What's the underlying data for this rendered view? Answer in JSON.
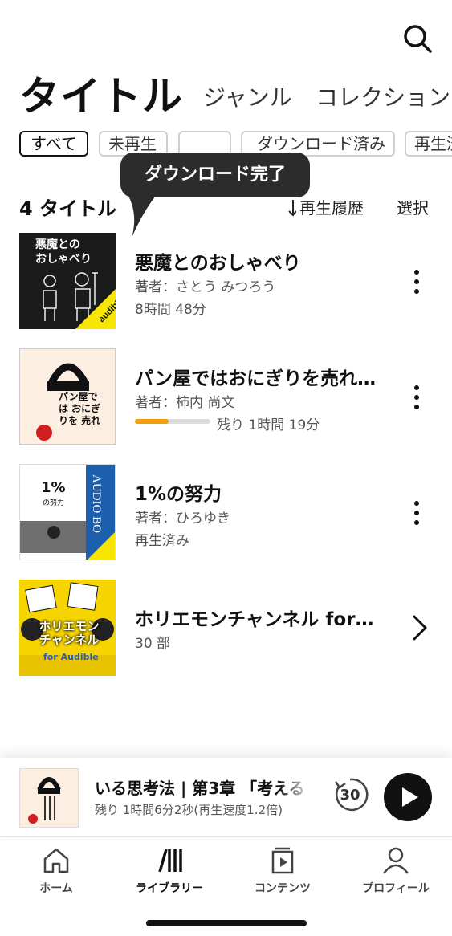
{
  "header": {
    "tabs": [
      {
        "label": "タイトル",
        "active": true
      },
      {
        "label": "ジャンル",
        "active": false
      },
      {
        "label": "コレクション",
        "active": false
      }
    ],
    "search_icon": "search-icon"
  },
  "filters": [
    {
      "label": "すべて",
      "active": true
    },
    {
      "label": "未再生",
      "active": false
    },
    {
      "label": "",
      "active": false
    },
    {
      "label": "ダウンロード済み",
      "active": false
    },
    {
      "label": "再生済み",
      "active": false
    }
  ],
  "tooltip": {
    "text": "ダウンロード完了"
  },
  "list_header": {
    "count": "4 タイトル",
    "sort_label": "再生履歴",
    "select_label": "選択"
  },
  "items": [
    {
      "title": "悪魔とのおしゃべり",
      "author": "著者：さとう みつろう",
      "meta": "8時間 48分",
      "cover_title": "悪魔との\nおしゃべり"
    },
    {
      "title": "パン屋ではおにぎりを売れ…",
      "author": "著者：柿内 尚文",
      "progress": 0.45,
      "meta": "残り 1時間 19分",
      "cover_title": "パン屋では おにぎりを 売れ"
    },
    {
      "title": "1%の努力",
      "author": "著者：ひろゆき",
      "meta": "再生済み",
      "cover_title": "1%",
      "cover_subtitle": "の努力",
      "cover_side": "AUDIO BO"
    },
    {
      "title": "ホリエモンチャンネル for…",
      "meta": "30 部",
      "cover_title": "ホリエモン チャンネル",
      "cover_sub": "for Audible"
    }
  ],
  "player": {
    "title": "いる思考法 | 第3章 「考える",
    "subtitle": "残り 1時間6分2秒(再生速度1.2倍)",
    "rewind_seconds": "30"
  },
  "bottom_nav": [
    {
      "label": "ホーム",
      "icon": "home-icon",
      "active": false
    },
    {
      "label": "ライブラリー",
      "icon": "library-icon",
      "active": true
    },
    {
      "label": "コンテンツ",
      "icon": "content-icon",
      "active": false
    },
    {
      "label": "プロフィール",
      "icon": "profile-icon",
      "active": false
    }
  ],
  "colors": {
    "accent": "#f39c12",
    "text": "#111111",
    "tooltip_bg": "#2c2c2c",
    "audible_yellow": "#f6e600"
  }
}
